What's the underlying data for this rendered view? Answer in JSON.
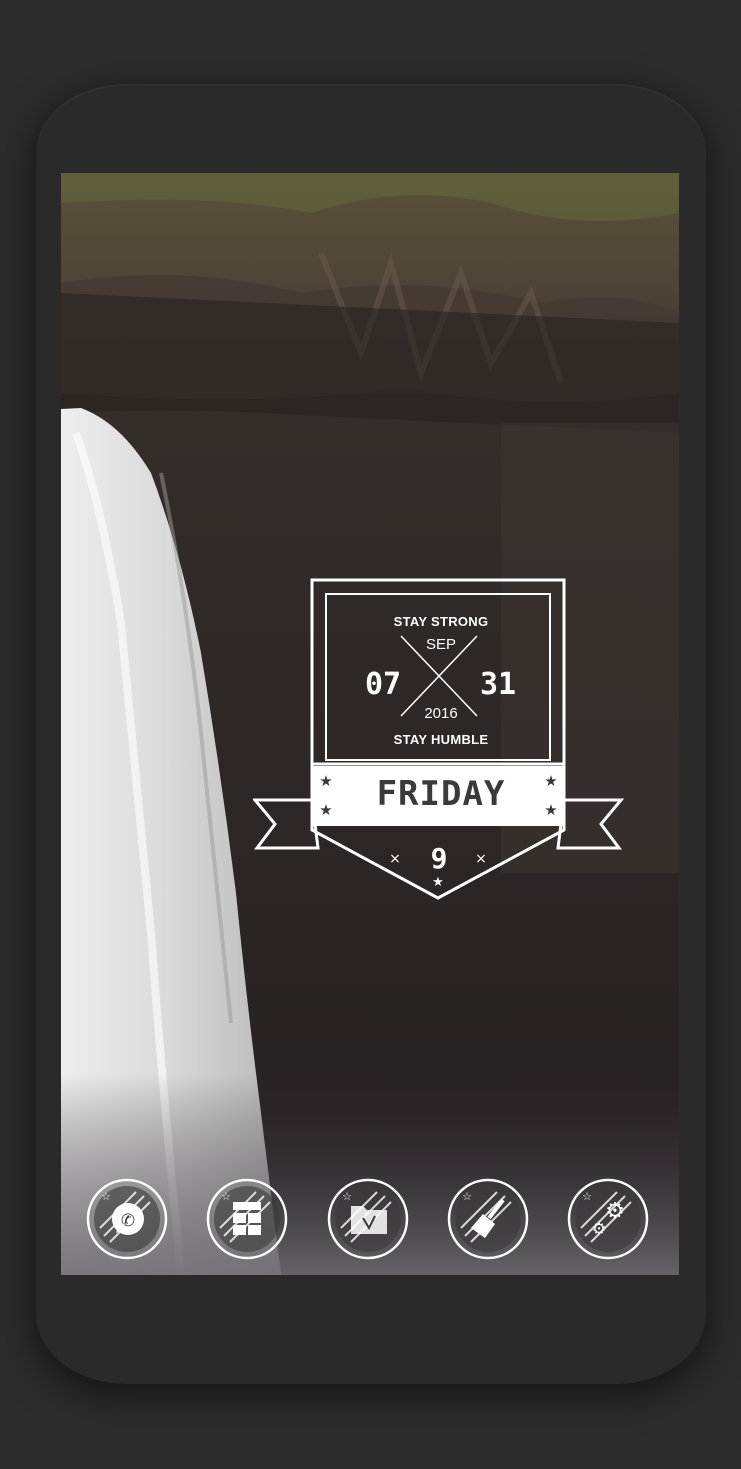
{
  "widget": {
    "top_line": "STAY STRONG",
    "month": "SEP",
    "hour": "07",
    "minute": "31",
    "year": "2016",
    "bottom_line": "STAY HUMBLE",
    "weekday": "FRIDAY",
    "hour_number": "9"
  },
  "dock": {
    "apps": [
      {
        "icon": "whatsapp-icon"
      },
      {
        "icon": "windows-store-icon"
      },
      {
        "icon": "file-manager-icon"
      },
      {
        "icon": "cleaner-broom-icon"
      },
      {
        "icon": "settings-gears-icon"
      }
    ]
  },
  "colors": {
    "frame": "#2a2a2b",
    "background": "#2c2c2c",
    "widget_white": "#ffffff",
    "weekday_text": "#3a3a3a"
  }
}
